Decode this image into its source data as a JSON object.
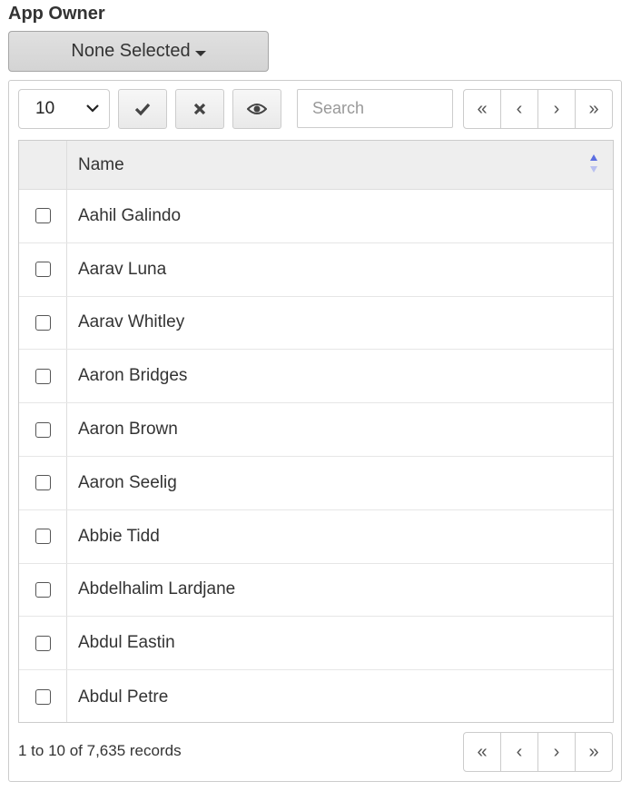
{
  "field": {
    "label": "App Owner"
  },
  "dropdown": {
    "label": "None Selected"
  },
  "toolbar": {
    "page_size": "10",
    "select_all_icon": "check-icon",
    "clear_icon": "x-icon",
    "view_icon": "eye-icon",
    "search_placeholder": "Search"
  },
  "pager": {
    "first": "«",
    "prev": "‹",
    "next": "›",
    "last": "»"
  },
  "table": {
    "columns": [
      "Name"
    ],
    "sort": "ascending",
    "rows": [
      "Aahil Galindo",
      "Aarav Luna",
      "Aarav Whitley",
      "Aaron Bridges",
      "Aaron Brown",
      "Aaron Seelig",
      "Abbie Tidd",
      "Abdelhalim Lardjane",
      "Abdul Eastin",
      "Abdul Petre"
    ]
  },
  "footer": {
    "records": "1 to 10 of 7,635 records"
  },
  "colors": {
    "sort_active": "#5b6ee1",
    "sort_inactive": "#b9c0f0"
  }
}
